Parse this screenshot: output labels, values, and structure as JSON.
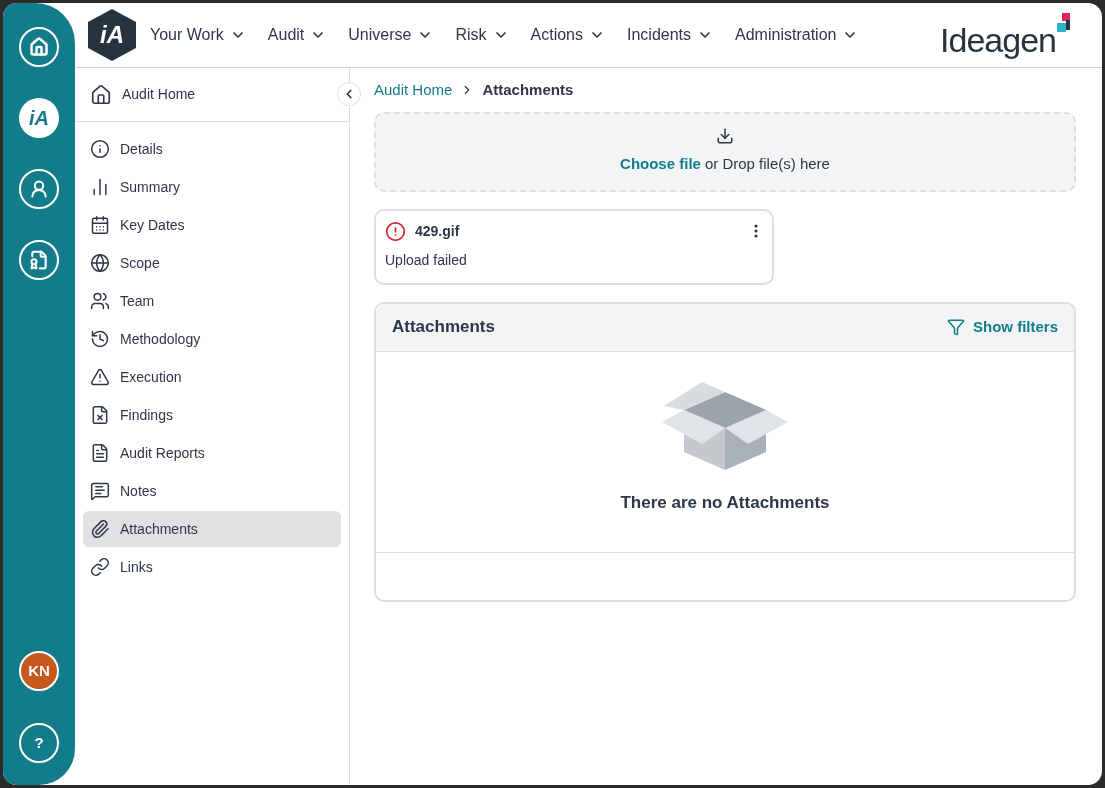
{
  "rail": {
    "items": [
      {
        "selected": false
      },
      {
        "label": "iA",
        "selected": true
      },
      {
        "selected": false
      },
      {
        "selected": false
      }
    ],
    "avatar": "KN",
    "help": "?"
  },
  "header": {
    "logo_mark": "iA",
    "nav": [
      {
        "label": "Your Work"
      },
      {
        "label": "Audit"
      },
      {
        "label": "Universe"
      },
      {
        "label": "Risk"
      },
      {
        "label": "Actions"
      },
      {
        "label": "Incidents"
      },
      {
        "label": "Administration"
      }
    ],
    "brand": "Ideagen"
  },
  "sidebar": {
    "home": {
      "label": "Audit Home"
    },
    "items": [
      {
        "label": "Details",
        "selected": false
      },
      {
        "label": "Summary",
        "selected": false
      },
      {
        "label": "Key Dates",
        "selected": false
      },
      {
        "label": "Scope",
        "selected": false
      },
      {
        "label": "Team",
        "selected": false
      },
      {
        "label": "Methodology",
        "selected": false
      },
      {
        "label": "Execution",
        "selected": false
      },
      {
        "label": "Findings",
        "selected": false
      },
      {
        "label": "Audit Reports",
        "selected": false
      },
      {
        "label": "Notes",
        "selected": false
      },
      {
        "label": "Attachments",
        "selected": true
      },
      {
        "label": "Links",
        "selected": false
      }
    ]
  },
  "breadcrumb": [
    {
      "label": "Audit Home",
      "kind": "link"
    },
    {
      "label": "Attachments",
      "kind": "current"
    }
  ],
  "dropzone": {
    "link": "Choose file",
    "text": "or Drop file(s) here"
  },
  "upload": {
    "file": "429.gif",
    "status": "Upload failed",
    "failed": true
  },
  "attachments": {
    "title": "Attachments",
    "filter": "Show filters",
    "empty": "There are no Attachments"
  }
}
